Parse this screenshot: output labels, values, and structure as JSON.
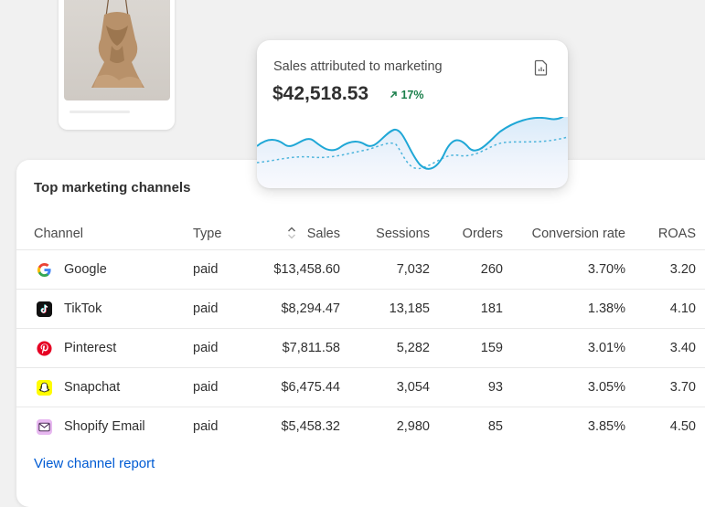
{
  "sales_card": {
    "title": "Sales attributed to marketing",
    "value": "$42,518.53",
    "change": "17%",
    "change_icon": "arrow-up-right-icon",
    "report_icon": "report-icon"
  },
  "table": {
    "title": "Top marketing channels",
    "headers": {
      "channel": "Channel",
      "type": "Type",
      "sales": "Sales",
      "sessions": "Sessions",
      "orders": "Orders",
      "conversion": "Conversion rate",
      "roas": "ROAS"
    },
    "rows": [
      {
        "channel": "Google",
        "icon": "google-icon",
        "type": "paid",
        "sales": "$13,458.60",
        "sessions": "7,032",
        "orders": "260",
        "conversion": "3.70%",
        "roas": "3.20"
      },
      {
        "channel": "TikTok",
        "icon": "tiktok-icon",
        "type": "paid",
        "sales": "$8,294.47",
        "sessions": "13,185",
        "orders": "181",
        "conversion": "1.38%",
        "roas": "4.10"
      },
      {
        "channel": "Pinterest",
        "icon": "pinterest-icon",
        "type": "paid",
        "sales": "$7,811.58",
        "sessions": "5,282",
        "orders": "159",
        "conversion": "3.01%",
        "roas": "3.40"
      },
      {
        "channel": "Snapchat",
        "icon": "snapchat-icon",
        "type": "paid",
        "sales": "$6,475.44",
        "sessions": "3,054",
        "orders": "93",
        "conversion": "3.05%",
        "roas": "3.70"
      },
      {
        "channel": "Shopify Email",
        "icon": "shopify-email-icon",
        "type": "paid",
        "sales": "$5,458.32",
        "sessions": "2,980",
        "orders": "85",
        "conversion": "3.85%",
        "roas": "4.50"
      }
    ],
    "link": "View channel report"
  },
  "colors": {
    "accent_link": "#005bd3",
    "positive": "#1a7f4b",
    "sparkline": "#1fa7d6",
    "sparkline_dotted": "#4bb4dc"
  }
}
